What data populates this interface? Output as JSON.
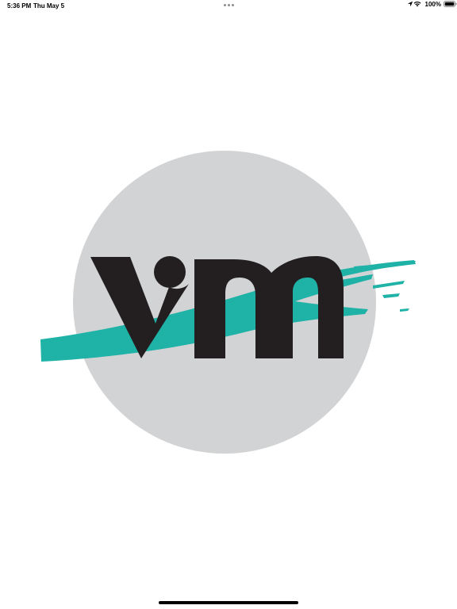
{
  "status_bar": {
    "time": "5:36 PM",
    "date": "Thu May 5",
    "battery_percent": "100%",
    "icons": [
      "location-arrow-icon",
      "wifi-icon",
      "battery-full-icon"
    ]
  },
  "splash": {
    "logo_text": "vm",
    "colors": {
      "circle": "#d2d3d5",
      "brush_stroke": "#1fb2a6",
      "letters": "#231f20"
    }
  }
}
